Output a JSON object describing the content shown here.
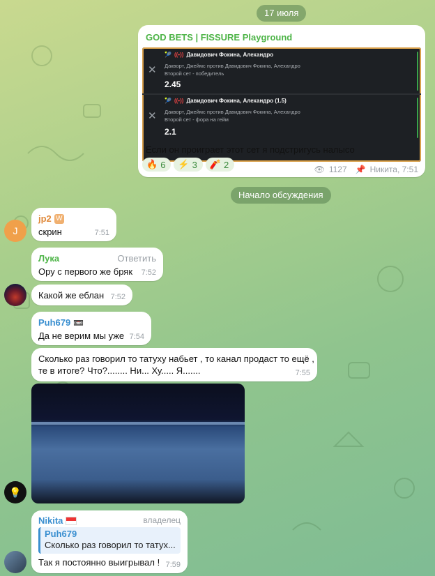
{
  "date_pill": "17 июля",
  "channel_post": {
    "channel_name": "GOD BETS | FISSURE Playground",
    "bets": [
      {
        "title": "Давидович Фокина, Алехандро",
        "match": "Дакворт, Джеймс против Давидович Фокина, Алехандро",
        "market": "Второй сет - победитель",
        "odds": "2.45"
      },
      {
        "title": "Давидович Фокина, Алехандро (1.5)",
        "match": "Дакворт, Джеймс против Давидович Фокина, Алехандро",
        "market": "Второй сет - фора на гейм",
        "odds": "2.1"
      }
    ],
    "text": "Если он проиграет этот сет я подстригусь налысо",
    "reactions": [
      {
        "icon": "fire-icon",
        "count": "6"
      },
      {
        "icon": "lightning-icon",
        "count": "3"
      },
      {
        "icon": "fire-alt-icon",
        "count": "2"
      }
    ],
    "views": "1127",
    "footer": "Никита, 7:51"
  },
  "discussion_pill": "Начало обсуждения",
  "messages": [
    {
      "sender": "jp2",
      "text": "скрин",
      "time": "7:51"
    },
    {
      "sender": "Лука",
      "action": "Ответить",
      "text": "Ору с первого же бряк",
      "time": "7:52"
    },
    {
      "text": "Какой же еблан",
      "time": "7:52"
    },
    {
      "sender": "Puh679",
      "text": "Да не верим мы уже",
      "time": "7:54"
    },
    {
      "text": "Сколько раз говорил то татуху набьет , то канал продаст то ещё ,",
      "text2": "те  в итоге? Что?........ Ни... Ху..... Я.......",
      "time": "7:55"
    },
    {
      "sender": "Nikita",
      "role": "владелец",
      "reply_name": "Puh679",
      "reply_text": "Сколько раз говорил то татух...",
      "text": "Так я постоянно выигрывал !",
      "time": "7:59"
    }
  ],
  "avatar_letter": "J",
  "colors": {
    "green_accent": "#4db447",
    "jp2_name": "#e08a3c",
    "puh_name": "#3a8fd0",
    "luka_name": "#4db447",
    "nikita_name": "#3a8fd0"
  }
}
